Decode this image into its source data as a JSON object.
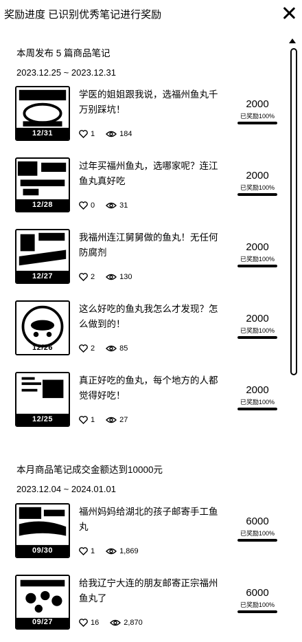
{
  "header": {
    "title": "奖励进度 已识别优秀笔记进行奖励"
  },
  "sections": [
    {
      "title": "本周发布 5 篇商品笔记",
      "range": "2023.12.25 ~ 2023.12.31",
      "items": [
        {
          "title": "学医的姐姐跟我说，选福州鱼丸千万别踩坑！",
          "thumb_date": "12/31",
          "likes": "1",
          "views": "184",
          "reward": "2000",
          "progress_label": "已奖励100%",
          "progress": 1.0
        },
        {
          "title": "过年买福州鱼丸，选哪家呢？连江鱼丸真好吃",
          "thumb_date": "12/28",
          "likes": "0",
          "views": "31",
          "reward": "2000",
          "progress_label": "已奖励100%",
          "progress": 1.0
        },
        {
          "title": "我福州连江舅舅做的鱼丸！无任何防腐剂",
          "thumb_date": "12/27",
          "likes": "2",
          "views": "130",
          "reward": "2000",
          "progress_label": "已奖励100%",
          "progress": 1.0
        },
        {
          "title": "这么好吃的鱼丸我怎么才发现？怎么做到的！",
          "thumb_date": "12/26",
          "likes": "2",
          "views": "85",
          "reward": "2000",
          "progress_label": "已奖励100%",
          "progress": 1.0
        },
        {
          "title": "真正好吃的鱼丸，每个地方的人都觉得好吃！",
          "thumb_date": "12/25",
          "likes": "1",
          "views": "27",
          "reward": "2000",
          "progress_label": "已奖励100%",
          "progress": 1.0
        }
      ]
    },
    {
      "title": "本月商品笔记成交金额达到10000元",
      "range": "2023.12.04 ~ 2024.01.01",
      "items": [
        {
          "title": "福州妈妈给湖北的孩子邮寄手工鱼丸",
          "thumb_date": "09/30",
          "likes": "1",
          "views": "1,869",
          "reward": "6000",
          "progress_label": "已奖励100%",
          "progress": 1.0
        },
        {
          "title": "给我辽宁大连的朋友邮寄正宗福州鱼丸了",
          "thumb_date": "09/27",
          "likes": "16",
          "views": "2,870",
          "reward": "6000",
          "progress_label": "已奖励100%",
          "progress": 1.0
        }
      ]
    }
  ]
}
